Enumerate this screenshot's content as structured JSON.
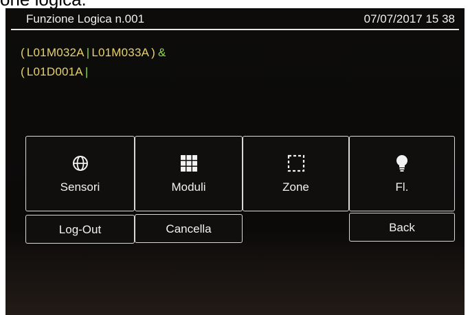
{
  "caption": "one logica.",
  "header": {
    "title": "Funzione Logica n.001",
    "datetime": "07/07/2017 15 38"
  },
  "expression": {
    "line1": {
      "open": "(",
      "term1": "L01M032A",
      "sep": "|",
      "term2": "L01M033A",
      "close": ")",
      "operator": "&"
    },
    "line2": {
      "open": "(",
      "term1": "L01D001A",
      "sep": "|"
    }
  },
  "buttons": {
    "sensori": {
      "label": "Sensori",
      "icon": "globe-icon"
    },
    "moduli": {
      "label": "Moduli",
      "icon": "grid-icon"
    },
    "zone": {
      "label": "Zone",
      "icon": "dashed-square-icon"
    },
    "fl": {
      "label": "Fl.",
      "icon": "lightbulb-icon"
    },
    "logout": {
      "label": "Log-Out"
    },
    "cancella": {
      "label": "Cancella"
    },
    "back": {
      "label": "Back"
    }
  },
  "colors": {
    "expression_term": "#e7d36a",
    "expression_operator": "#8fd94a",
    "text": "#f2f2f2",
    "border": "#d9d9d9"
  }
}
